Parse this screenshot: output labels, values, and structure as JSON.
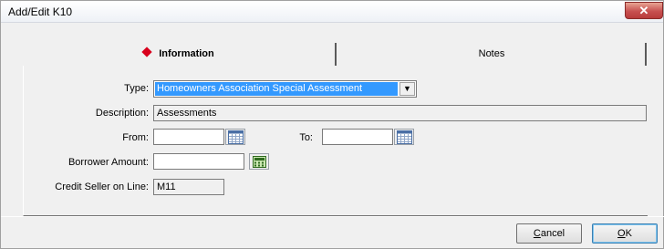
{
  "window": {
    "title": "Add/Edit K10",
    "close_glyph": "✕"
  },
  "tabs": [
    {
      "label": "Information",
      "active": true
    },
    {
      "label": "Notes",
      "active": false
    }
  ],
  "form": {
    "type_label": "Type:",
    "type_value": "Homeowners Association Special Assessment",
    "description_label": "Description:",
    "description_value": "Assessments",
    "from_label": "From:",
    "from_value": "",
    "to_label": "To:",
    "to_value": "",
    "borrower_amount_label": "Borrower Amount:",
    "borrower_amount_value": "",
    "credit_seller_label": "Credit Seller on Line:",
    "credit_seller_value": "M11"
  },
  "buttons": {
    "cancel_prefix": "",
    "cancel_underlined": "C",
    "cancel_rest": "ancel",
    "ok_underlined": "O",
    "ok_rest": "K"
  },
  "colors": {
    "active_tab_marker": "#d8001c",
    "selection_highlight": "#3399ff",
    "close_button": "#c75050"
  }
}
